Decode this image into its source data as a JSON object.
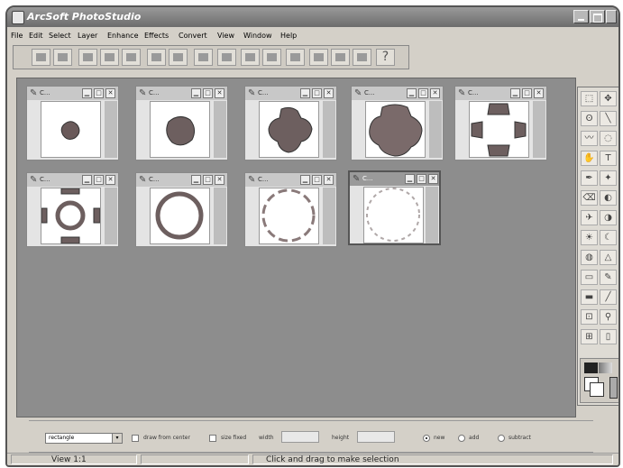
{
  "app": {
    "title": "ArcSoft PhotoStudio"
  },
  "menu": [
    "File",
    "Edit",
    "Select",
    "Layer",
    "Enhance",
    "Effects",
    "Convert",
    "View",
    "Window",
    "Help"
  ],
  "toolbar_icons": [
    "new-icon",
    "open-icon",
    "save-icon",
    "brush-icon",
    "stamp-icon",
    "scan-icon",
    "pen-icon",
    "copy-icon",
    "paste-icon",
    "undo-icon",
    "redo-icon",
    "wand-icon",
    "enhance-icon",
    "adjust-icon",
    "print-icon"
  ],
  "toolbar_help": "?",
  "documents": [
    {
      "name": "C..."
    },
    {
      "name": "C..."
    },
    {
      "name": "C..."
    },
    {
      "name": "C..."
    },
    {
      "name": "C..."
    },
    {
      "name": "C..."
    },
    {
      "name": "C..."
    },
    {
      "name": "C..."
    },
    {
      "name": "C..."
    }
  ],
  "toolbox": {
    "tools": [
      "select-rect-icon",
      "move-icon",
      "lasso-icon",
      "line-icon",
      "smudge-icon",
      "clone-icon",
      "hand-icon",
      "text-icon",
      "pen-tool-icon",
      "wand-tool-icon",
      "eraser-icon",
      "fill-icon",
      "airbrush-icon",
      "blur-icon",
      "dodge-icon",
      "burn-icon",
      "sponge-icon",
      "sharpen-icon",
      "shape-icon",
      "brush-tool-icon",
      "rect-icon",
      "line-tool-icon",
      "crop-icon",
      "eyedropper-icon",
      "zoom-icon",
      "help-tool-icon"
    ],
    "glyphs": [
      "⬚",
      "✥",
      "ʘ",
      "╲",
      "〰",
      "◌",
      "✋",
      "T",
      "✒",
      "✦",
      "⌫",
      "◐",
      "✈",
      "◑",
      "☀",
      "☾",
      "◍",
      "△",
      "▭",
      "✎",
      "▬",
      "╱",
      "⊡",
      "⚲",
      "⊞",
      "▯"
    ]
  },
  "options": {
    "mode": "rectangle",
    "draw_from_center": "draw from center",
    "size_fixed": "size fixed",
    "width_label": "width",
    "height_label": "height",
    "new_label": "new",
    "add_label": "add",
    "subtract_label": "subtract"
  },
  "status": {
    "view": "View 1:1",
    "hint": "Click and drag to make selection"
  }
}
